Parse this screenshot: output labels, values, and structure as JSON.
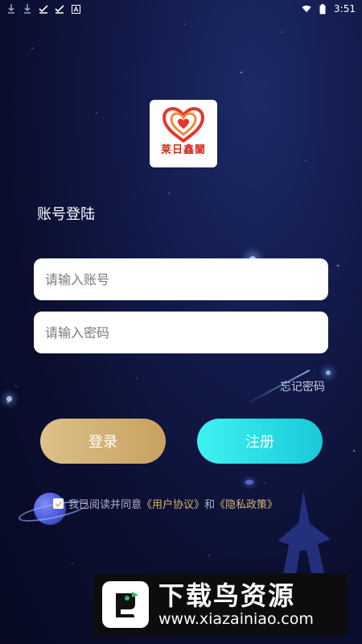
{
  "status_bar": {
    "time": "3:51",
    "left_icons": [
      "download-icon",
      "download-icon",
      "check-icon",
      "check-icon",
      "a-icon"
    ],
    "right_icons": [
      "wifi-icon",
      "battery-icon"
    ]
  },
  "logo": {
    "text": "莱日鑫閫",
    "subtext": "· · ·  · · ·"
  },
  "login": {
    "title": "账号登陆",
    "account_placeholder": "请输入账号",
    "password_placeholder": "请输入密码",
    "forgot_label": "忘记密码",
    "login_button": "登录",
    "register_button": "注册"
  },
  "agreement": {
    "checked": true,
    "prefix": "我已阅读并同意",
    "user_agreement": "《用户协议》",
    "and": "和",
    "privacy_policy": "《隐私政策》"
  },
  "watermark": {
    "title": "下载鸟资源",
    "url": "www.xiazainiao.com"
  },
  "colors": {
    "login_gold": "#d4b276",
    "register_cyan": "#2ae3e8",
    "link_gold": "#d9b36c",
    "logo_red": "#d7291f"
  }
}
